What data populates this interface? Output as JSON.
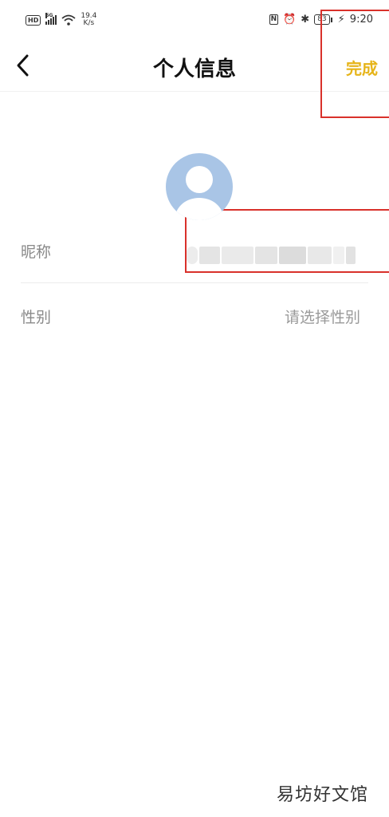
{
  "status_bar": {
    "left": {
      "hd": "HD",
      "network": "5G",
      "speed_value": "19.4",
      "speed_unit": "K/s"
    },
    "right": {
      "nfc": "N",
      "battery": "83",
      "time": "9:20"
    }
  },
  "header": {
    "title": "个人信息",
    "done_label": "完成"
  },
  "profile": {
    "nickname_label": "昵称",
    "gender_label": "性别",
    "gender_placeholder": "请选择性别"
  },
  "watermark": "易坊好文馆",
  "colors": {
    "accent": "#e6b419",
    "annotation_red": "#d9312b",
    "avatar_bg": "#a9c5e6"
  }
}
